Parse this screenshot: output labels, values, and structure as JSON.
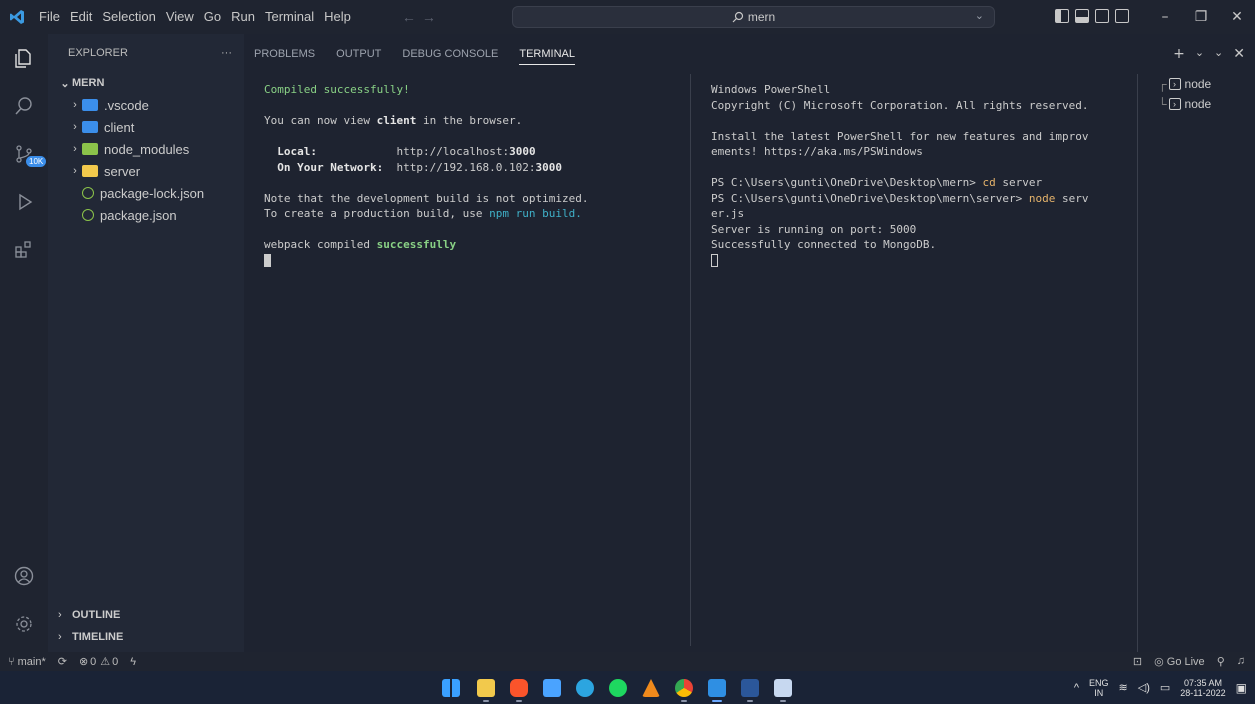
{
  "titlebar": {
    "menu": [
      "File",
      "Edit",
      "Selection",
      "View",
      "Go",
      "Run",
      "Terminal",
      "Help"
    ],
    "search": "mern",
    "icons": [
      "vscode-logo-icon",
      "back-arrow-icon",
      "forward-arrow-icon",
      "search-icon",
      "layout-icons",
      "minimize-icon",
      "restore-icon",
      "close-icon"
    ]
  },
  "sidebar": {
    "title": "EXPLORER",
    "more": "···",
    "root": "MERN",
    "items": [
      {
        "label": ".vscode",
        "type": "folder",
        "color": "#3b8eea"
      },
      {
        "label": "client",
        "type": "folder",
        "color": "#3b8eea"
      },
      {
        "label": "node_modules",
        "type": "folder",
        "color": "#8bc34a"
      },
      {
        "label": "server",
        "type": "folder",
        "color": "#f2c94c"
      },
      {
        "label": "package-lock.json",
        "type": "file",
        "color": "#8bc34a"
      },
      {
        "label": "package.json",
        "type": "file",
        "color": "#8bc34a"
      }
    ],
    "outline": "OUTLINE",
    "timeline": "TIMELINE"
  },
  "activity": {
    "badge": "10K"
  },
  "panel": {
    "tabs": [
      "PROBLEMS",
      "OUTPUT",
      "DEBUG CONSOLE",
      "TERMINAL"
    ],
    "active_tab": "TERMINAL",
    "terminal1": {
      "compiled": "Compiled successfully!",
      "view_pre": "You can now view ",
      "view_bold": "client",
      "view_post": " in the browser.",
      "local_label": "Local:",
      "local_url_pre": "http://localhost:",
      "local_port": "3000",
      "net_label": "On Your Network:",
      "net_url_pre": "http://192.168.0.102:",
      "net_port": "3000",
      "note1": "Note that the development build is not optimized.",
      "note2_pre": "To create a production build, use ",
      "note2_cmd": "npm run build",
      "note2_post": ".",
      "webpack_pre": "webpack compiled ",
      "webpack_ok": "successfully"
    },
    "terminal2": {
      "l1": "Windows PowerShell",
      "l2": "Copyright (C) Microsoft Corporation. All rights reserved.",
      "l3": "Install the latest PowerShell for new features and improv",
      "l4": "ements! https://aka.ms/PSWindows",
      "l5_prompt": "PS C:\\Users\\gunti\\OneDrive\\Desktop\\mern> ",
      "l5_cmd": "cd",
      "l5_arg": " server",
      "l6_prompt": "PS C:\\Users\\gunti\\OneDrive\\Desktop\\mern\\server> ",
      "l6_cmd": "node",
      "l6_arg": " serv",
      "l7": "er.js",
      "l8": "Server is running on port: 5000",
      "l9": "Successfully connected to MongoDB."
    },
    "terminal_list": [
      "node",
      "node"
    ]
  },
  "statusbar": {
    "branch": "main*",
    "errors": "0",
    "warnings": "0",
    "golive": "Go Live"
  },
  "tray": {
    "lang1": "ENG",
    "lang2": "IN",
    "time": "07:35 AM",
    "date": "28-11-2022"
  }
}
